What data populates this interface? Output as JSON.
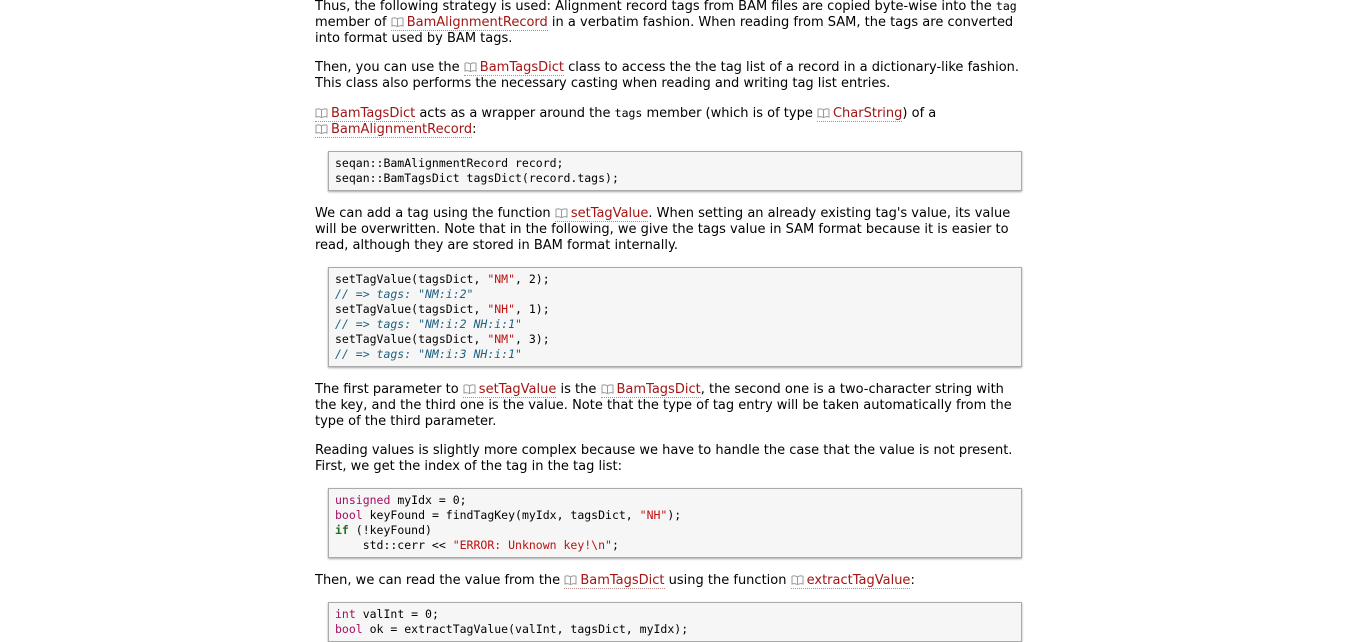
{
  "p1": {
    "a": "Thus, the following strategy is used: Alignment record tags from BAM files are copied byte-wise into the ",
    "code": "tag",
    "b": "member of ",
    "ref": "BamAlignmentRecord",
    "c": " in a verbatim fashion. When reading from SAM, the tags are converted",
    "d": "into format used by BAM tags."
  },
  "p2": {
    "a": "Then, you can use the ",
    "ref": "BamTagsDict",
    "b": " class to access the the tag list of a record in a dictionary-like fashion.",
    "c": "This class also performs the necessary casting when reading and writing tag list entries."
  },
  "p3": {
    "ref1": "BamTagsDict",
    "a": " acts as a wrapper around the ",
    "code": "tags",
    "b": " member (which is of type ",
    "ref2": "CharString",
    "c": ") of a",
    "ref3": "BamAlignmentRecord",
    "d": ":"
  },
  "code1": [
    "seqan::BamAlignmentRecord record;",
    "seqan::BamTagsDict tagsDict(record.tags);"
  ],
  "p4": {
    "a": "We can add a tag using the function ",
    "ref": "setTagValue",
    "b": ". When setting an already existing tag's value, its value",
    "c": "will be overwritten. Note that in the following, we give the tags value in SAM format because it is easier to",
    "d": "read, although they are stored in BAM format internally."
  },
  "code2": {
    "fn": "setTagValue(tagsDict, ",
    "keys": [
      "\"NM\"",
      "\"NH\"",
      "\"NM\""
    ],
    "vals": [
      ", 2);",
      ", 1);",
      ", 3);"
    ],
    "comments": [
      "// => tags: \"NM:i:2\"",
      "// => tags: \"NM:i:2 NH:i:1\"",
      "// => tags: \"NM:i:3 NH:i:1\""
    ]
  },
  "p5": {
    "a": "The first parameter to ",
    "ref1": "setTagValue",
    "b": " is the ",
    "ref2": "BamTagsDict",
    "c": ", the second one is a two-character string with",
    "d": "the key, and the third one is the value. Note that the type of tag entry will be taken automatically from the",
    "e": "type of the third parameter."
  },
  "p6": {
    "a": "Reading values is slightly more complex because we have to handle the case that the value is not present.",
    "b": "First, we get the index of the tag in the tag list:"
  },
  "code3": {
    "l1kw": "unsigned",
    "l1rest": " myIdx = 0;",
    "l2kw": "bool",
    "l2rest": " keyFound = findTagKey(myIdx, tagsDict, ",
    "l2str": "\"NH\"",
    "l2end": ");",
    "l3kw": "if",
    "l3rest": " (!keyFound)",
    "l4a": "    std::cerr << ",
    "l4str": "\"ERROR: Unknown key!\\n\"",
    "l4end": ";"
  },
  "p7": {
    "a": "Then, we can read the value from the ",
    "ref1": "BamTagsDict",
    "b": " using the function ",
    "ref2": "extractTagValue",
    "c": ":"
  },
  "code4": {
    "l1kw": "int",
    "l1rest": " valInt = 0;",
    "l2kw": "bool",
    "l2rest": " ok = extractTagValue(valInt, tagsDict, myIdx);"
  },
  "icons": {
    "ref": "book-icon"
  },
  "colors": {
    "link": "#a31515",
    "string": "#c01010",
    "comment": "#206080",
    "keyword": "#a01060"
  }
}
